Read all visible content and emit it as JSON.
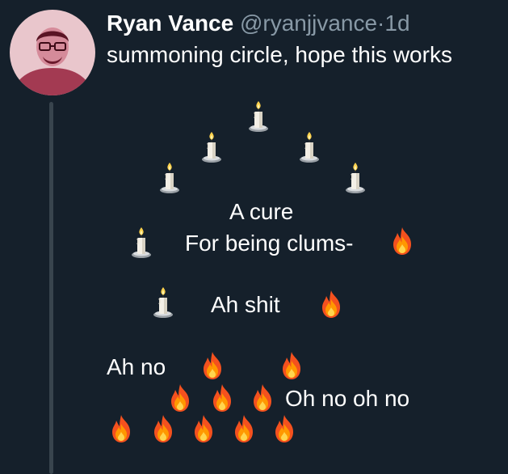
{
  "tweet": {
    "author_name": "Ryan Vance",
    "handle": "@ryanjjvance",
    "separator": "·",
    "time_ago": "1d",
    "text": "summoning circle, hope this works"
  },
  "body_lines": {
    "a_cure": "A cure",
    "for_being_clums": "For being clums-",
    "ah_shit": "Ah shit",
    "ah_no": "Ah no",
    "oh_no_oh_no": "Oh no oh no"
  },
  "emojis": {
    "candle": "candle-emoji",
    "fire": "fire-emoji"
  },
  "colors": {
    "background": "#15202b",
    "secondary_text": "#8899a6",
    "thread_line": "#38444d"
  }
}
